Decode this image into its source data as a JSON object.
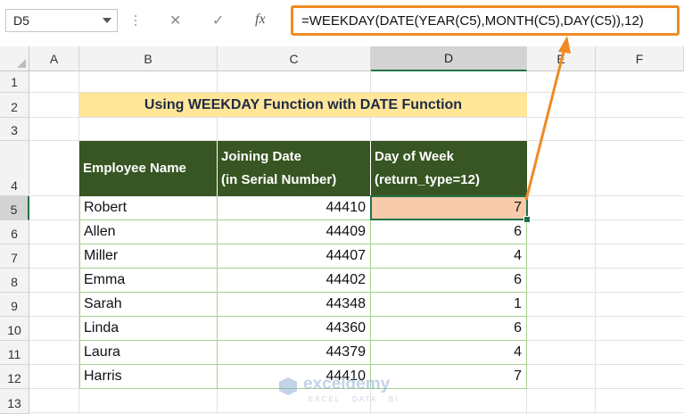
{
  "formula_bar": {
    "name_box": "D5",
    "cancel_glyph": "✕",
    "enter_glyph": "✓",
    "fx_label": "fx",
    "formula": "=WEEKDAY(DATE(YEAR(C5),MONTH(C5),DAY(C5)),12)"
  },
  "columns": [
    "A",
    "B",
    "C",
    "D",
    "E",
    "F"
  ],
  "rows": [
    "1",
    "2",
    "3",
    "4",
    "5",
    "6",
    "7",
    "8",
    "9",
    "10",
    "11",
    "12",
    "13"
  ],
  "title": "Using WEEKDAY Function with DATE Function",
  "table": {
    "headers": {
      "name": "Employee Name",
      "date_line1": "Joining Date",
      "date_line2": "(in Serial Number)",
      "day_line1": "Day of Week",
      "day_line2": "(return_type=12)"
    },
    "rows": [
      {
        "name": "Robert",
        "serial": "44410",
        "day": "7"
      },
      {
        "name": "Allen",
        "serial": "44409",
        "day": "6"
      },
      {
        "name": "Miller",
        "serial": "44407",
        "day": "4"
      },
      {
        "name": "Emma",
        "serial": "44402",
        "day": "6"
      },
      {
        "name": "Sarah",
        "serial": "44348",
        "day": "1"
      },
      {
        "name": "Linda",
        "serial": "44360",
        "day": "6"
      },
      {
        "name": "Laura",
        "serial": "44379",
        "day": "4"
      },
      {
        "name": "Harris",
        "serial": "44410",
        "day": "7"
      }
    ]
  },
  "colors": {
    "header_bg": "#375623",
    "title_bg": "#ffe699",
    "highlight_cell": "#f8cbad",
    "annotation": "#f08a24",
    "selection": "#217346"
  },
  "watermark": {
    "brand": "exceldemy",
    "tagline": "EXCEL · DATA · BI"
  }
}
